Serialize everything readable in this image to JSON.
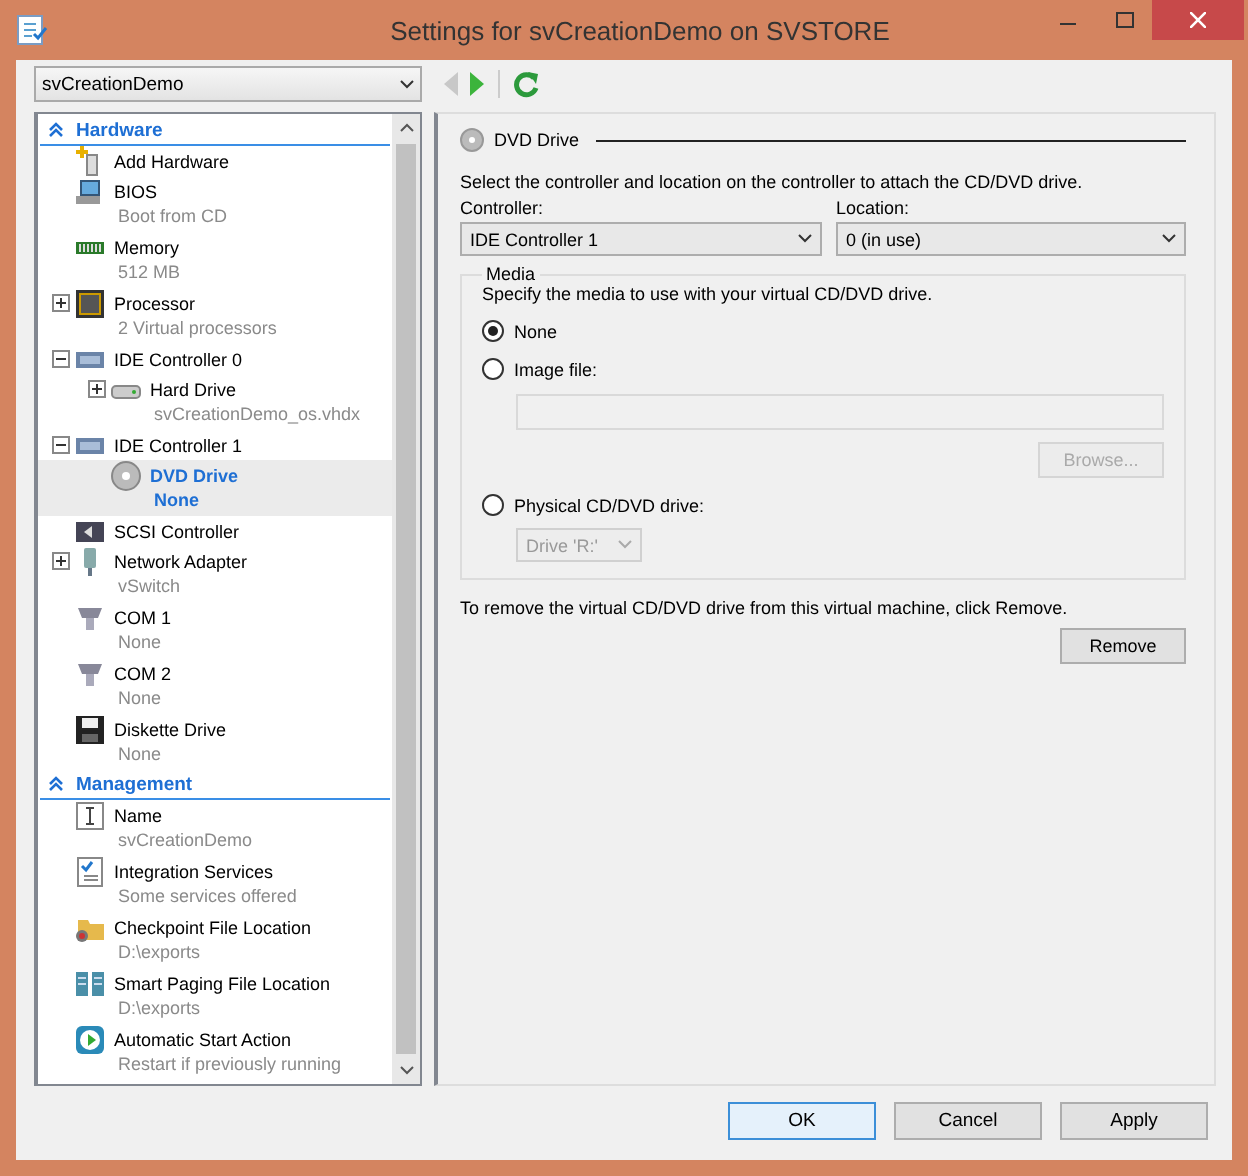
{
  "window": {
    "title": "Settings for svCreationDemo on SVSTORE"
  },
  "vm_selector": {
    "value": "svCreationDemo"
  },
  "toolbar": [
    {
      "kind": "back",
      "disabled": true
    },
    {
      "kind": "forward",
      "disabled": false
    },
    {
      "kind": "refresh",
      "disabled": false
    }
  ],
  "tree": {
    "sections": [
      {
        "title": "Hardware",
        "expanded": true,
        "items": [
          {
            "label": "Add Hardware",
            "selected": false
          },
          {
            "label": "BIOS",
            "detail": "Boot from CD",
            "selected": false
          },
          {
            "label": "Memory",
            "detail": "512 MB",
            "selected": false
          },
          {
            "label": "Processor",
            "detail": "2 Virtual processors",
            "expanded": false,
            "selected": false
          },
          {
            "label": "IDE Controller 0",
            "expanded": true,
            "selected": false,
            "children": [
              {
                "label": "Hard Drive",
                "detail": "svCreationDemo_os.vhdx",
                "expanded": false,
                "selected": false
              }
            ]
          },
          {
            "label": "IDE Controller 1",
            "expanded": true,
            "selected": false,
            "children": [
              {
                "label": "DVD Drive",
                "detail": "None",
                "selected": true
              }
            ]
          },
          {
            "label": "SCSI Controller",
            "selected": false
          },
          {
            "label": "Network Adapter",
            "detail": "vSwitch",
            "expanded": false,
            "selected": false
          },
          {
            "label": "COM 1",
            "detail": "None",
            "selected": false
          },
          {
            "label": "COM 2",
            "detail": "None",
            "selected": false
          },
          {
            "label": "Diskette Drive",
            "detail": "None",
            "selected": false
          }
        ]
      },
      {
        "title": "Management",
        "expanded": true,
        "items": [
          {
            "label": "Name",
            "detail": "svCreationDemo",
            "selected": false
          },
          {
            "label": "Integration Services",
            "detail": "Some services offered",
            "selected": false
          },
          {
            "label": "Checkpoint File Location",
            "detail": "D:\\exports",
            "selected": false
          },
          {
            "label": "Smart Paging File Location",
            "detail": "D:\\exports",
            "selected": false
          },
          {
            "label": "Automatic Start Action",
            "detail": "Restart if previously running",
            "selected": false
          }
        ]
      }
    ]
  },
  "details": {
    "title": "DVD Drive",
    "intro": "Select the controller and location on the controller to attach the CD/DVD drive.",
    "controller": {
      "label": "Controller:",
      "value": "IDE Controller 1"
    },
    "location": {
      "label": "Location:",
      "value": "0 (in use)"
    },
    "media": {
      "legend": "Media",
      "hint": "Specify the media to use with your virtual CD/DVD drive.",
      "options": [
        {
          "kind": "none",
          "label": "None",
          "selected": true
        },
        {
          "kind": "file",
          "label": "Image file:",
          "selected": false
        },
        {
          "kind": "drive",
          "label": "Physical CD/DVD drive:",
          "selected": false
        }
      ],
      "image_field": {
        "disabled": true
      },
      "browse": {
        "label": "Browse...",
        "disabled": true
      },
      "drive": {
        "value": "Drive 'R:'",
        "disabled": true
      }
    },
    "remove_hint": "To remove the virtual CD/DVD drive from this virtual machine, click Remove.",
    "remove_button": "Remove"
  },
  "buttons": [
    {
      "label": "OK",
      "default": true
    },
    {
      "label": "Cancel",
      "default": false
    },
    {
      "label": "Apply",
      "default": false
    }
  ]
}
